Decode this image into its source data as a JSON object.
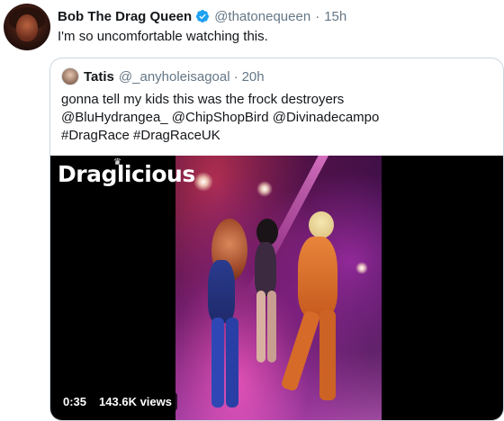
{
  "tweet": {
    "author_name": "Bob The Drag Queen",
    "author_handle": "@thatonequeen",
    "separator": "·",
    "time": "15h",
    "text": "I'm so uncomfortable watching this."
  },
  "quoted": {
    "author_name": "Tatis",
    "author_handle": "@_anyholeisagoal",
    "separator": "·",
    "time": "20h",
    "lines": [
      "gonna tell my kids this was the frock destroyers",
      "@BluHydrangea_ @ChipShopBird @Divinadecampo",
      "#DragRace #DragRaceUK"
    ]
  },
  "video": {
    "logo_text": "Draglicious",
    "elapsed": "0:35",
    "views": "143.6K views"
  },
  "colors": {
    "verified": "#1da1f2",
    "secondary_text": "#657786",
    "border": "#ccd6dd"
  },
  "icons": {
    "verified": "verified-badge-icon"
  }
}
